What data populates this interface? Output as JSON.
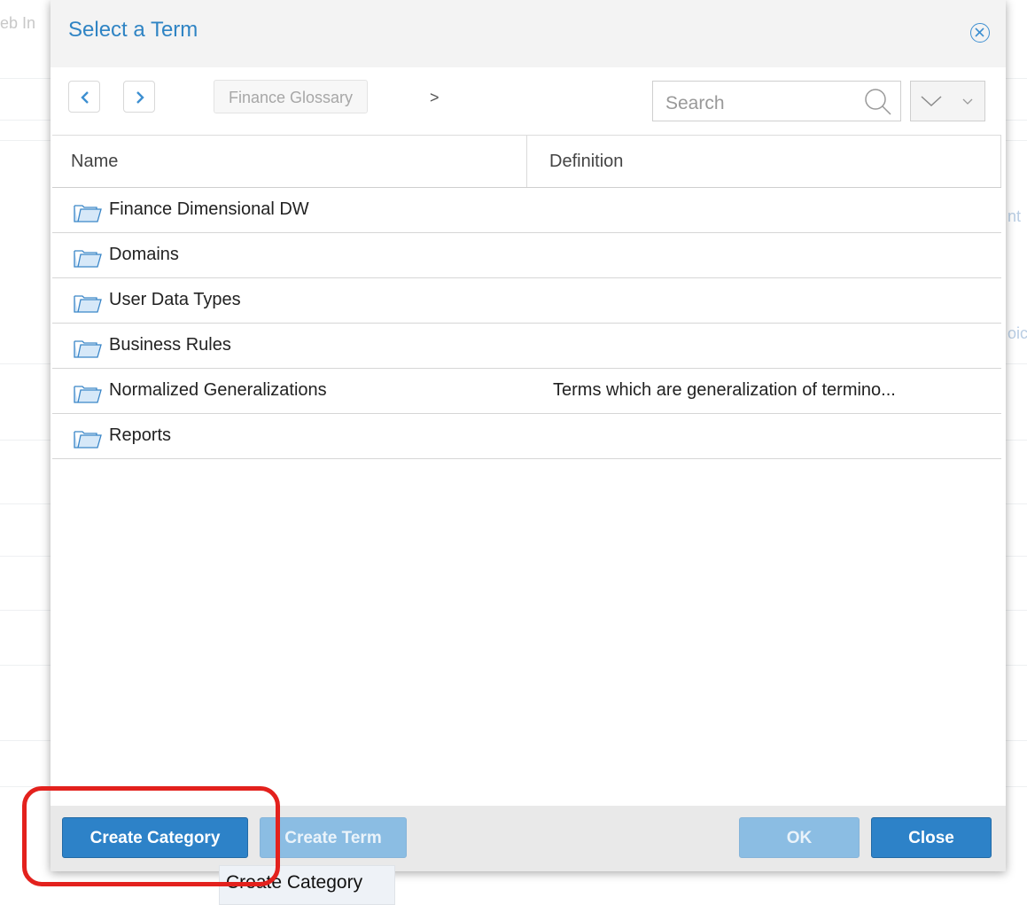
{
  "background": {
    "top_left_fragment": "eb In",
    "right_fragment_1": "nt",
    "right_fragment_2": "oic"
  },
  "dialog": {
    "title": "Select a Term",
    "breadcrumb": "Finance Glossary",
    "breadcrumb_separator": ">",
    "search_placeholder": "Search",
    "columns": {
      "name": "Name",
      "definition": "Definition"
    },
    "rows": [
      {
        "name": "Finance Dimensional DW",
        "definition": ""
      },
      {
        "name": "Domains",
        "definition": ""
      },
      {
        "name": "User Data Types",
        "definition": ""
      },
      {
        "name": "Business Rules",
        "definition": ""
      },
      {
        "name": "Normalized Generalizations",
        "definition": "Terms which are generalization of termino..."
      },
      {
        "name": "Reports",
        "definition": ""
      }
    ],
    "footer": {
      "create_category": "Create Category",
      "create_term": "Create Term",
      "ok": "OK",
      "close": "Close"
    },
    "tooltip": "Create Category"
  },
  "colors": {
    "accent": "#2d82c8",
    "title": "#2f84c4",
    "disabled": "#8bbde3",
    "annotation": "#e3211d"
  }
}
